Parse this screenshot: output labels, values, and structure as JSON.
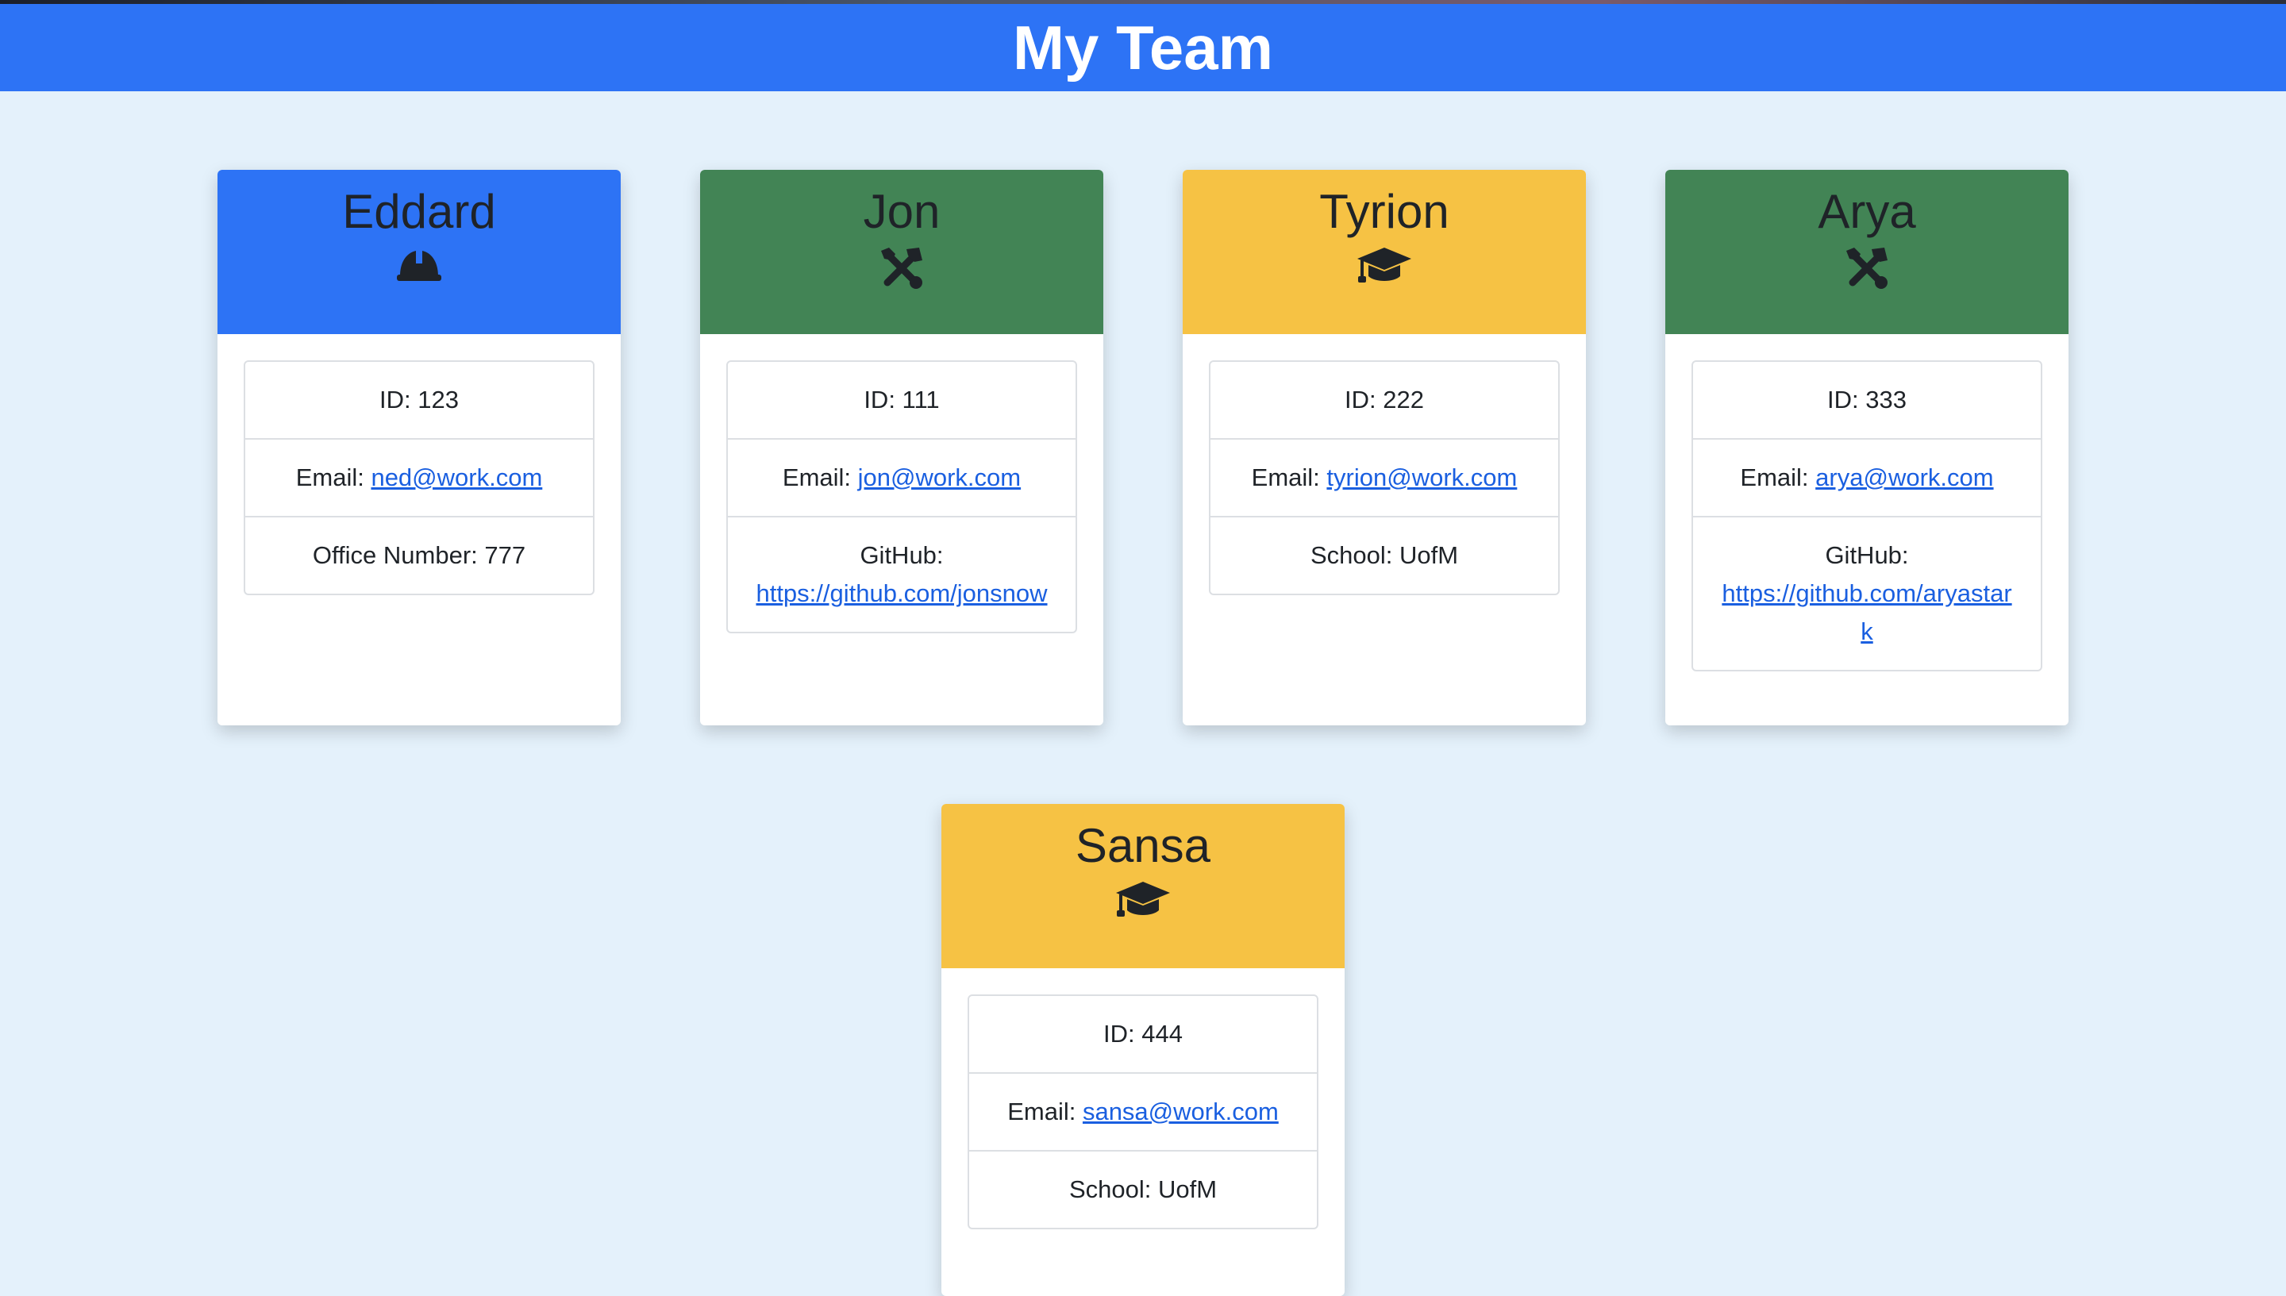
{
  "header": {
    "title": "My Team"
  },
  "team": [
    {
      "name": "Eddard",
      "role_icon": "hard-hat-icon",
      "header_color": "#2d73f5",
      "id_text": "ID: 123",
      "email_label": "Email: ",
      "email": "ned@work.com",
      "extra_label": "Office Number: 777",
      "extra_link": ""
    },
    {
      "name": "Jon",
      "role_icon": "tools-icon",
      "header_color": "#428455",
      "id_text": "ID: 111",
      "email_label": "Email: ",
      "email": "jon@work.com",
      "extra_label": "GitHub:",
      "extra_link": "https://github.com/jonsnow"
    },
    {
      "name": "Tyrion",
      "role_icon": "graduation-cap-icon",
      "header_color": "#f6c244",
      "id_text": "ID: 222",
      "email_label": "Email: ",
      "email": "tyrion@work.com",
      "extra_label": "School: UofM",
      "extra_link": ""
    },
    {
      "name": "Arya",
      "role_icon": "tools-icon",
      "header_color": "#428455",
      "id_text": "ID: 333",
      "email_label": "Email: ",
      "email": "arya@work.com",
      "extra_label": "GitHub:",
      "extra_link": "https://github.com/aryastark"
    },
    {
      "name": "Sansa",
      "role_icon": "graduation-cap-icon",
      "header_color": "#f6c244",
      "id_text": "ID: 444",
      "email_label": "Email: ",
      "email": "sansa@work.com",
      "extra_label": "School: UofM",
      "extra_link": ""
    }
  ]
}
